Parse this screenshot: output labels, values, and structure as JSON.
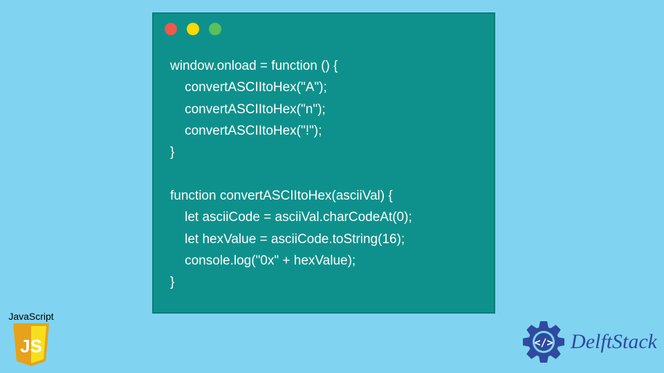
{
  "code": "window.onload = function () {\n    convertASCIItoHex(\"A\");\n    convertASCIItoHex(\"n\");\n    convertASCIItoHex(\"!\");\n}\n\nfunction convertASCIItoHex(asciiVal) {\n    let asciiCode = asciiVal.charCodeAt(0);\n    let hexValue = asciiCode.toString(16);\n    console.log(\"0x\" + hexValue);\n}",
  "js_label": "JavaScript",
  "js_shield_text": "JS",
  "brand": "DelftStack",
  "colors": {
    "background": "#80d4f2",
    "window": "#0e918c",
    "code_text": "#ffffff",
    "dot_red": "#ed594a",
    "dot_yellow": "#fdd800",
    "dot_green": "#5ac05a",
    "brand_blue": "#2f4a9e",
    "js_yellow": "#f7df1e"
  }
}
